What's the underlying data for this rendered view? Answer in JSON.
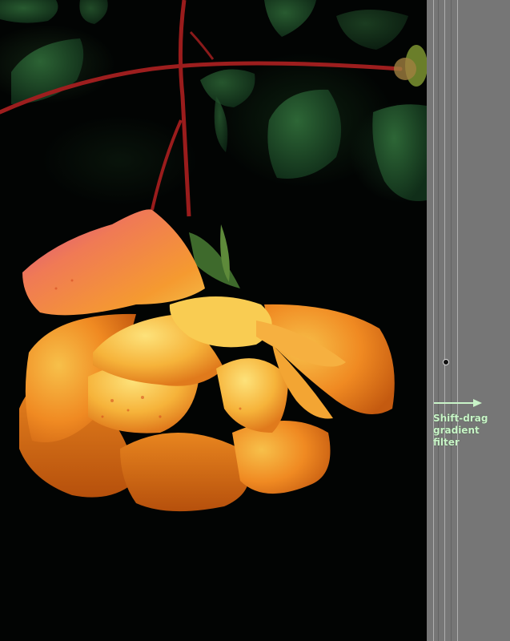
{
  "hint": {
    "text": "Shift-drag\ngradient\nfilter",
    "color": "#c9f4c8"
  },
  "photo": {
    "subject": "orange-rose",
    "background_color": "#020403"
  },
  "panel": {
    "color": "#767676"
  },
  "icons": {
    "arrow": "right-arrow-icon",
    "pin": "gradient-pin-icon"
  }
}
